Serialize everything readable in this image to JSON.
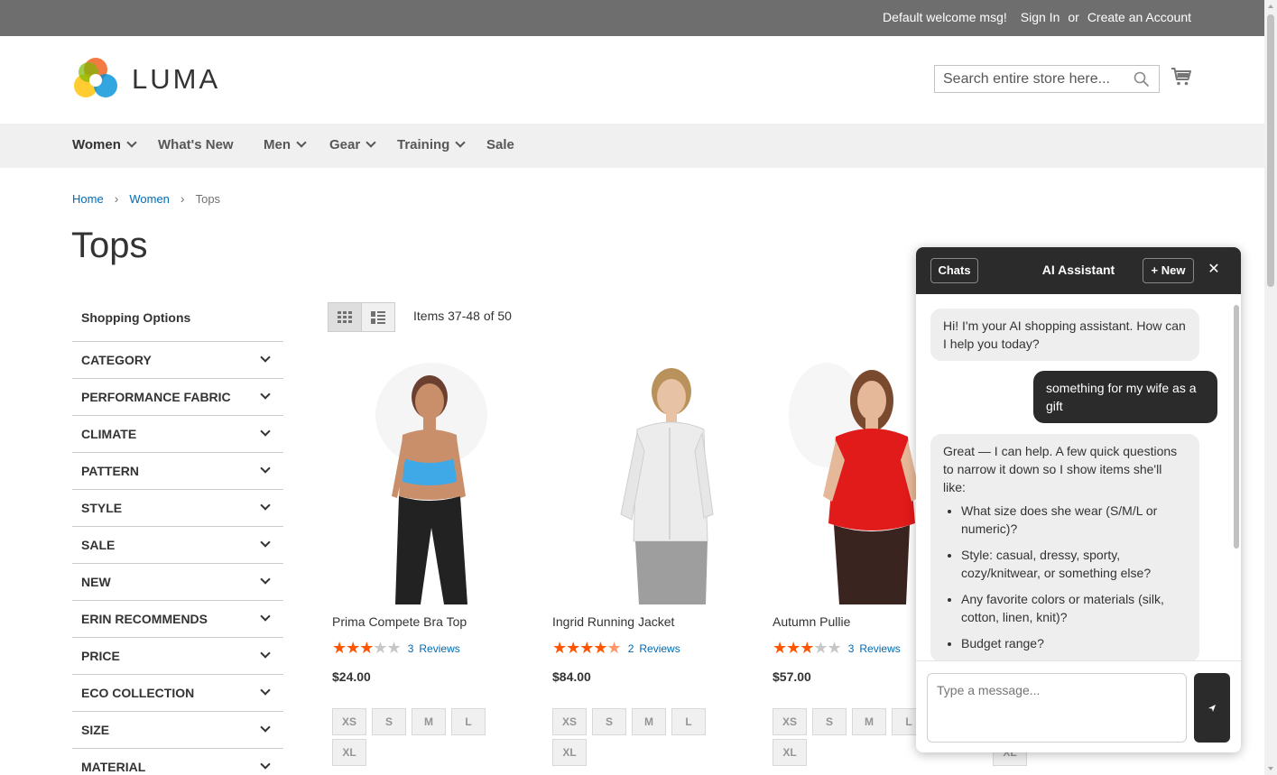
{
  "topbar": {
    "welcome": "Default welcome msg!",
    "sign_in": "Sign In",
    "or": "or",
    "create_account": "Create an Account"
  },
  "header": {
    "logo_text": "LUMA",
    "search_placeholder": "Search entire store here...",
    "search_icon": "magnifier-icon",
    "cart_icon": "shopping-cart-icon"
  },
  "nav": {
    "items": [
      {
        "label": "Women",
        "has_menu": true,
        "active": true
      },
      {
        "label": "What's New",
        "has_menu": false
      },
      {
        "label": "Men",
        "has_menu": true
      },
      {
        "label": "Gear",
        "has_menu": true
      },
      {
        "label": "Training",
        "has_menu": true
      },
      {
        "label": "Sale",
        "has_menu": false
      }
    ],
    "active_color": "#ff5501"
  },
  "breadcrumb": {
    "items": [
      "Home",
      "Women"
    ],
    "current": "Tops"
  },
  "page": {
    "title": "Tops"
  },
  "sidebar": {
    "heading": "Shopping Options",
    "filters": [
      "CATEGORY",
      "PERFORMANCE FABRIC",
      "CLIMATE",
      "PATTERN",
      "STYLE",
      "SALE",
      "NEW",
      "ERIN RECOMMENDS",
      "PRICE",
      "ECO COLLECTION",
      "SIZE",
      "MATERIAL"
    ]
  },
  "toolbar": {
    "grid_icon": "grid-view-icon",
    "list_icon": "list-view-icon",
    "amount": "Items 37-48 of 50"
  },
  "products": [
    {
      "name": "Prima Compete Bra Top",
      "rating": 3,
      "reviews_count": "3",
      "reviews_label": "Reviews",
      "price": "$24.00",
      "sizes": [
        "XS",
        "S",
        "M",
        "L",
        "XL"
      ]
    },
    {
      "name": "Ingrid Running Jacket",
      "rating": 4.5,
      "reviews_count": "2",
      "reviews_label": "Reviews",
      "price": "$84.00",
      "sizes": [
        "XS",
        "S",
        "M",
        "L",
        "XL"
      ]
    },
    {
      "name": "Autumn Pullie",
      "rating": 3,
      "reviews_count": "3",
      "reviews_label": "Reviews",
      "price": "$57.00",
      "sizes": [
        "XS",
        "S",
        "M",
        "L",
        "XL"
      ]
    }
  ],
  "hidden_fourth_swatch": "XL",
  "chat": {
    "chats_label": "Chats",
    "title": "AI Assistant",
    "new_label": "+ New",
    "close_label": "✕",
    "messages": [
      {
        "role": "bot",
        "text": "Hi! I'm your AI shopping assistant. How can I help you today?"
      },
      {
        "role": "user",
        "text": "something for my wife as a gift"
      },
      {
        "role": "bot",
        "text": "Great — I can help. A few quick questions to narrow it down so I show items she'll like:",
        "bullets": [
          "What size does she wear (S/M/L or numeric)?",
          "Style: casual, dressy, sporty, cozy/knitwear, or something else?",
          "Any favorite colors or materials (silk, cotton, linen, knit)?",
          "Budget range?"
        ]
      }
    ],
    "input_placeholder": "Type a message...",
    "send_icon": "send-icon"
  }
}
